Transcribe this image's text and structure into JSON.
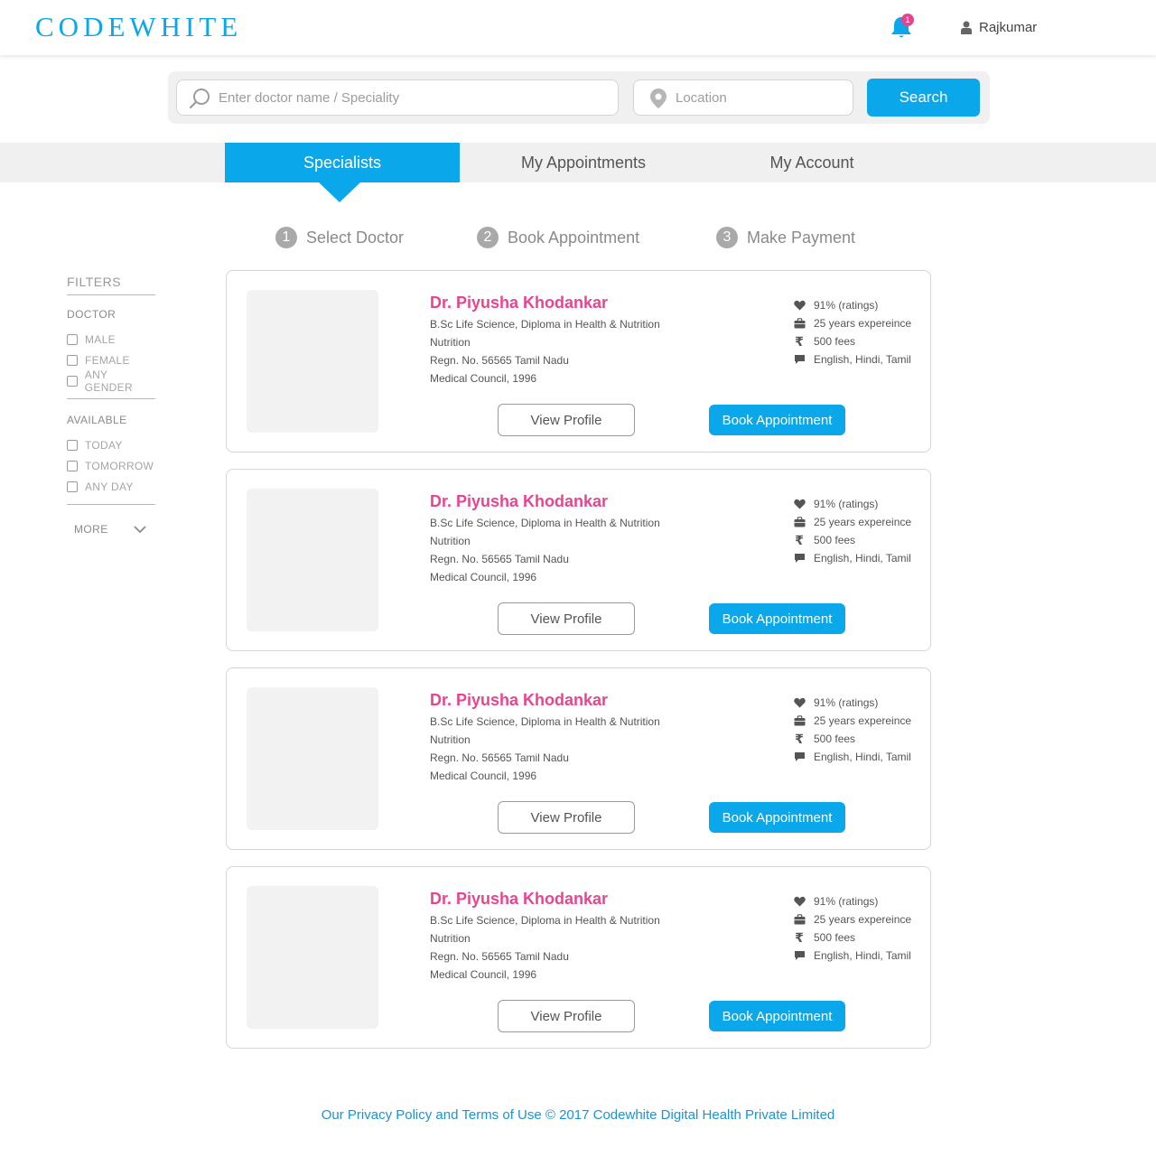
{
  "header": {
    "logo": "CODEWHITE",
    "notification_count": "1",
    "user_name": "Rajkumar"
  },
  "search": {
    "doctor_placeholder": "Enter doctor name / Speciality",
    "location_placeholder": "Location",
    "button_label": "Search"
  },
  "tabs": [
    {
      "label": "Specialists",
      "active": true
    },
    {
      "label": "My Appointments",
      "active": false
    },
    {
      "label": "My Account",
      "active": false
    }
  ],
  "steps": [
    {
      "num": "1",
      "label": "Select Doctor"
    },
    {
      "num": "2",
      "label": "Book Appointment"
    },
    {
      "num": "3",
      "label": "Make Payment"
    }
  ],
  "filters": {
    "title": "FILTERS",
    "doctor": {
      "title": "DOCTOR",
      "options": [
        "MALE",
        "FEMALE",
        "ANY GENDER"
      ]
    },
    "available": {
      "title": "AVAILABLE",
      "options": [
        "TODAY",
        "TOMORROW",
        "ANY DAY"
      ]
    },
    "more_label": "MORE"
  },
  "doctors": [
    {
      "name": "Dr. Piyusha Khodankar",
      "lines": [
        "B.Sc Life Science, Diploma in Health & Nutrition",
        "Nutrition",
        "Regn. No. 56565 Tamil Nadu",
        "Medical Council, 1996"
      ],
      "ratings": "91% (ratings)",
      "experience": "25 years expereince",
      "fees": "500 fees",
      "languages": "English,  Hindi, Tamil",
      "view_label": "View Profile",
      "book_label": "Book Appointment"
    },
    {
      "name": "Dr. Piyusha Khodankar",
      "lines": [
        "B.Sc Life Science, Diploma in Health & Nutrition",
        "Nutrition",
        "Regn. No. 56565 Tamil Nadu",
        "Medical Council, 1996"
      ],
      "ratings": "91% (ratings)",
      "experience": "25 years expereince",
      "fees": "500 fees",
      "languages": "English,  Hindi, Tamil",
      "view_label": "View Profile",
      "book_label": "Book Appointment"
    },
    {
      "name": "Dr. Piyusha Khodankar",
      "lines": [
        "B.Sc Life Science, Diploma in Health & Nutrition",
        "Nutrition",
        "Regn. No. 56565 Tamil Nadu",
        "Medical Council, 1996"
      ],
      "ratings": "91% (ratings)",
      "experience": "25 years expereince",
      "fees": "500 fees",
      "languages": "English,  Hindi, Tamil",
      "view_label": "View Profile",
      "book_label": "Book Appointment"
    },
    {
      "name": "Dr. Piyusha Khodankar",
      "lines": [
        "B.Sc Life Science, Diploma in Health & Nutrition",
        "Nutrition",
        "Regn. No. 56565 Tamil Nadu",
        "Medical Council, 1996"
      ],
      "ratings": "91% (ratings)",
      "experience": "25 years expereince",
      "fees": "500 fees",
      "languages": "English,  Hindi, Tamil",
      "view_label": "View Profile",
      "book_label": "Book Appointment"
    }
  ],
  "footer": {
    "text": "Our Privacy Policy and Terms of Use © 2017 Codewhite Digital Health Private Limited"
  },
  "icons": {
    "notification": "bell-icon",
    "user": "user-icon",
    "search": "search-icon",
    "location": "location-pin-icon",
    "ratings": "heart-icon",
    "experience": "briefcase-icon",
    "fees": "rupee-icon",
    "languages": "speech-bubble-icon",
    "more": "chevron-down-icon"
  },
  "colors": {
    "primary": "#0aa7ea",
    "doctor_name": "#e8458f",
    "badge": "#e8438f"
  }
}
